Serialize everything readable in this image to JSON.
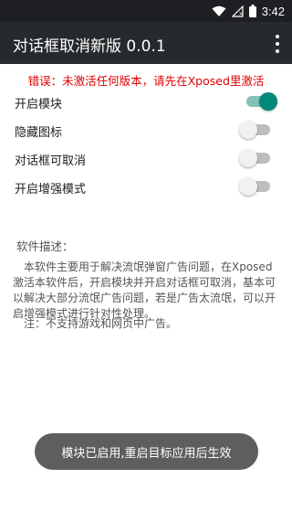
{
  "status_bar": {
    "time": "3:42",
    "icons": [
      "wifi-icon",
      "signal-icon",
      "battery-icon"
    ]
  },
  "app_bar": {
    "title": "对话框取消新版 0.0.1",
    "menu_icon": "more-vert-icon"
  },
  "error_text": "错误：未激活任何版本，请先在Xposed里激活",
  "settings": [
    {
      "label": "开启模块",
      "checked": true
    },
    {
      "label": "隐藏图标",
      "checked": false
    },
    {
      "label": "对话框可取消",
      "checked": false
    },
    {
      "label": "开启增强模式",
      "checked": false
    }
  ],
  "description": {
    "title": "软件描述：",
    "body": "本软件主要用于解决流氓弹窗广告问题，在Xposed激活本软件后，开启模块并开启对话框可取消，基本可以解决大部分流氓广告问题，若是广告太流氓，可以开启增强模式进行针对性处理。",
    "note": "注：不支持游戏和网页中广告。"
  },
  "toast": "模块已启用,重启目标应用后生效",
  "colors": {
    "status_bar": "#1e1f22",
    "app_bar": "#272a2d",
    "error": "#e00000",
    "switch_on": "#00897b",
    "toast_bg": "#5e5e5e"
  }
}
